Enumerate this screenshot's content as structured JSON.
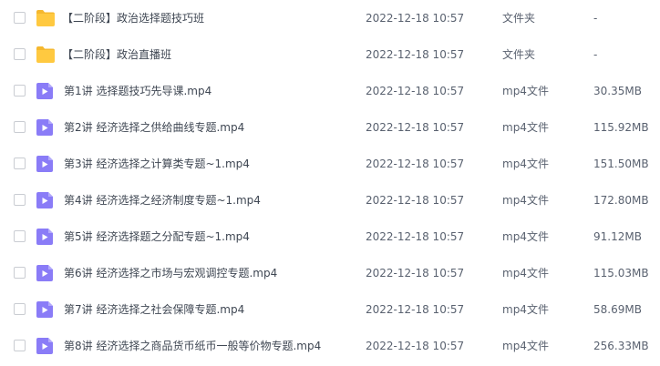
{
  "files": [
    {
      "name": "【二阶段】政治选择题技巧班",
      "date": "2022-12-18 10:57",
      "type": "文件夹",
      "size": "-",
      "icon": "folder-icon"
    },
    {
      "name": "【二阶段】政治直播班",
      "date": "2022-12-18 10:57",
      "type": "文件夹",
      "size": "-",
      "icon": "folder-icon"
    },
    {
      "name": "第1讲 选择题技巧先导课.mp4",
      "date": "2022-12-18 10:57",
      "type": "mp4文件",
      "size": "30.35MB",
      "icon": "video-file-icon"
    },
    {
      "name": "第2讲 经济选择之供给曲线专题.mp4",
      "date": "2022-12-18 10:57",
      "type": "mp4文件",
      "size": "115.92MB",
      "icon": "video-file-icon"
    },
    {
      "name": "第3讲 经济选择之计算类专题~1.mp4",
      "date": "2022-12-18 10:57",
      "type": "mp4文件",
      "size": "151.50MB",
      "icon": "video-file-icon"
    },
    {
      "name": "第4讲 经济选择之经济制度专题~1.mp4",
      "date": "2022-12-18 10:57",
      "type": "mp4文件",
      "size": "172.80MB",
      "icon": "video-file-icon"
    },
    {
      "name": "第5讲 经济选择题之分配专题~1.mp4",
      "date": "2022-12-18 10:57",
      "type": "mp4文件",
      "size": "91.12MB",
      "icon": "video-file-icon"
    },
    {
      "name": "第6讲 经济选择之市场与宏观调控专题.mp4",
      "date": "2022-12-18 10:57",
      "type": "mp4文件",
      "size": "115.03MB",
      "icon": "video-file-icon"
    },
    {
      "name": "第7讲 经济选择之社会保障专题.mp4",
      "date": "2022-12-18 10:57",
      "type": "mp4文件",
      "size": "58.69MB",
      "icon": "video-file-icon"
    },
    {
      "name": "第8讲 经济选择之商品货币纸币一般等价物专题.mp4",
      "date": "2022-12-18 10:57",
      "type": "mp4文件",
      "size": "256.33MB",
      "icon": "video-file-icon"
    }
  ],
  "colors": {
    "folder": "#ffc940",
    "folder_tab": "#f5b82e",
    "video": "#8a7cf7",
    "checkbox_border": "#c9ccd2"
  }
}
